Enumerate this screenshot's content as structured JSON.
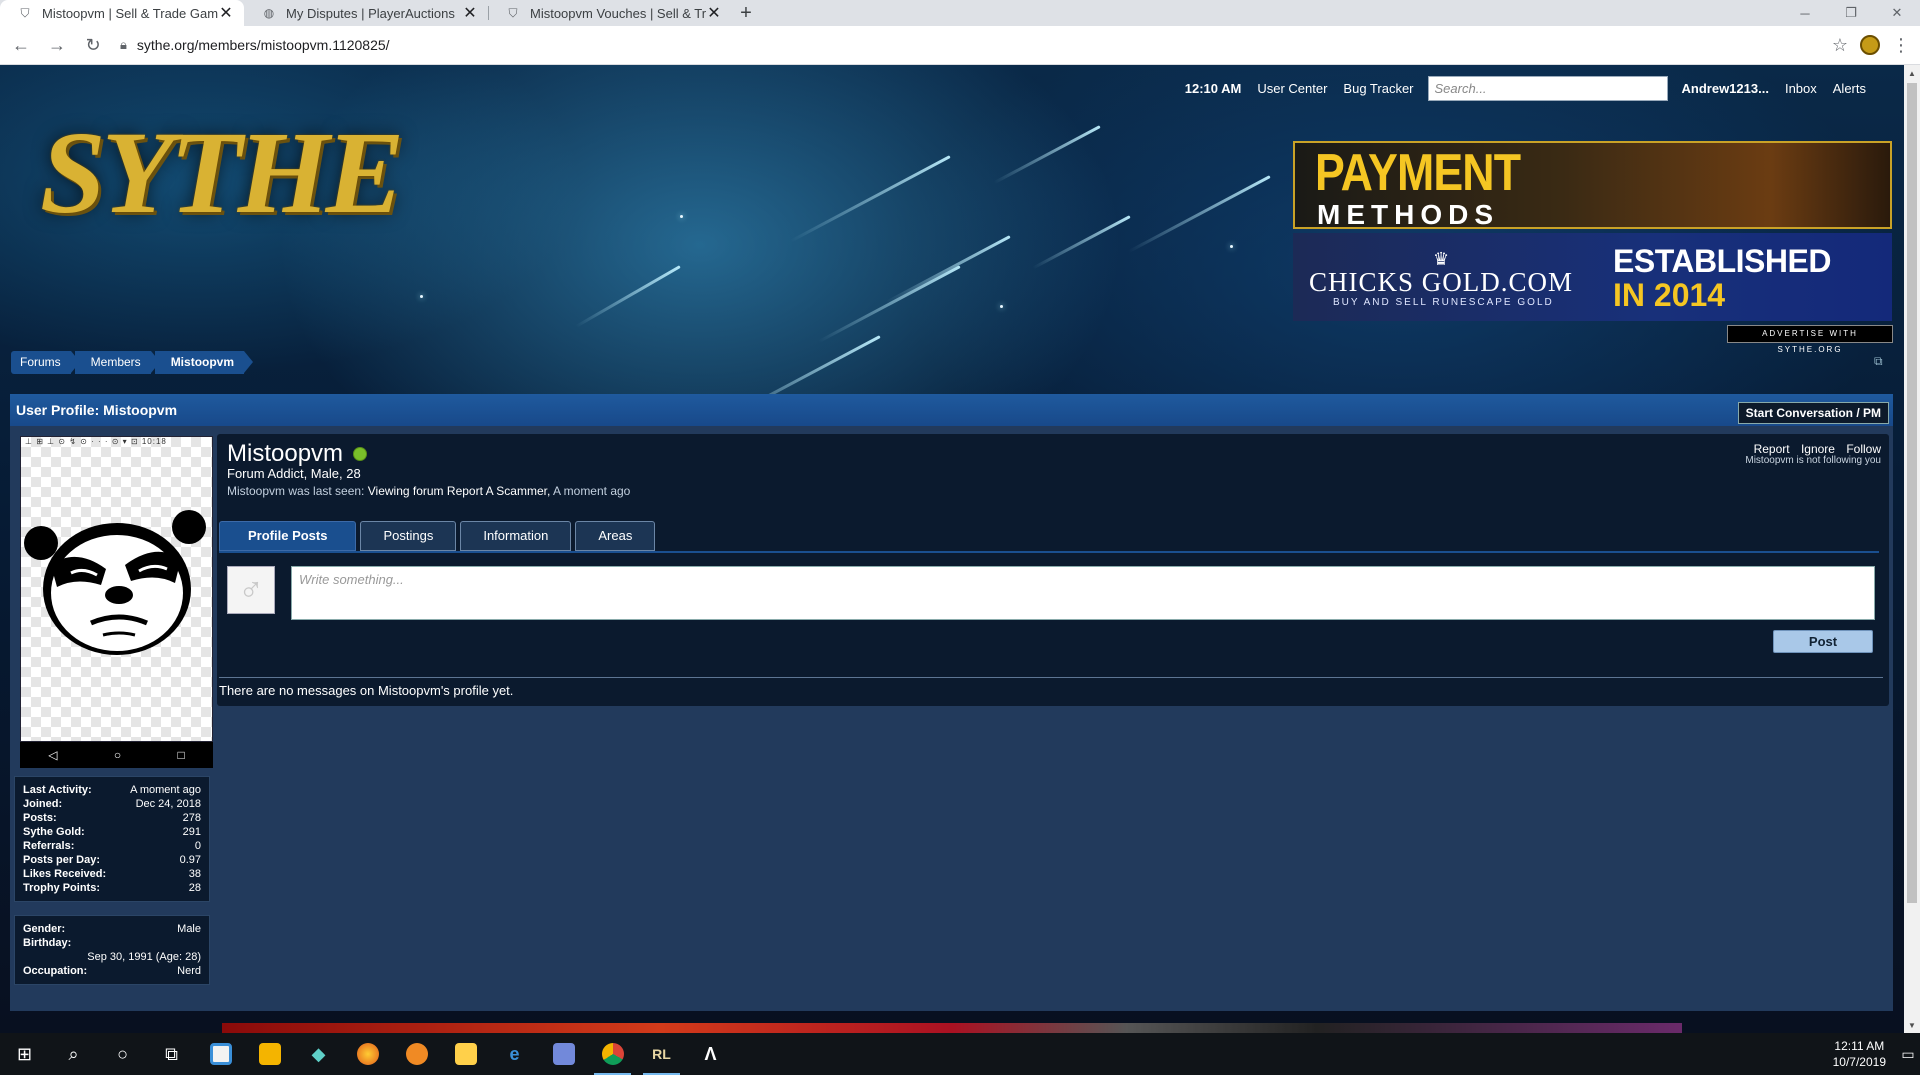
{
  "browser": {
    "tabs": [
      {
        "title": "Mistoopvm | Sell & Trade Game",
        "icon": "shield-icon",
        "active": true
      },
      {
        "title": "My Disputes | PlayerAuctions",
        "icon": "globe-icon",
        "active": false
      },
      {
        "title": "Mistoopvm Vouches | Sell & Trad",
        "icon": "shield-icon",
        "active": false
      }
    ],
    "close_glyph": "✕",
    "new_tab_glyph": "+",
    "url": "sythe.org/members/mistoopvm.1120825/"
  },
  "site": {
    "logo_text": "SYTHE",
    "time": "12:10 AM",
    "user_center": "User Center",
    "bug_tracker": "Bug Tracker",
    "search_placeholder": "Search...",
    "username": "Andrew1213...",
    "inbox": "Inbox",
    "alerts": "Alerts"
  },
  "ads": {
    "ad1_line1": "PAYMENT",
    "ad1_line2": "METHODS",
    "ad2_brand": "CHICKS GOLD.COM",
    "ad2_sub": "BUY AND SELL RUNESCAPE GOLD",
    "ad2_est": "ESTABLISHED",
    "ad2_year": "IN 2014",
    "advertise": "ADVERTISE WITH SYTHE.ORG"
  },
  "breadcrumb": [
    "Forums",
    "Members",
    "Mistoopvm"
  ],
  "profile": {
    "header": "User Profile: Mistoopvm",
    "start_conversation": "Start Conversation / PM",
    "name": "Mistoopvm",
    "title_line": "Forum Addict, Male, 28",
    "last_seen_prefix": "Mistoopvm was last seen:",
    "last_seen_action": "Viewing forum",
    "last_seen_forum": "Report A Scammer,",
    "last_seen_time": "A moment ago",
    "actions": {
      "report": "Report",
      "ignore": "Ignore",
      "follow": "Follow"
    },
    "follow_note": "Mistoopvm is not following you",
    "tabs": [
      "Profile Posts",
      "Postings",
      "Information",
      "Areas"
    ],
    "write_placeholder": "Write something...",
    "post_button": "Post",
    "no_messages": "There are no messages on Mistoopvm's profile yet.",
    "avatar_status_text": "⊥ ⊞ ⊥ ⊙ ↯ ⊙ · · · ⊙ ▾ ⊡  10:18",
    "stats": [
      {
        "k": "Last Activity:",
        "v": "A moment ago"
      },
      {
        "k": "Joined:",
        "v": "Dec 24, 2018"
      },
      {
        "k": "Posts:",
        "v": "278"
      },
      {
        "k": "Sythe Gold:",
        "v": "291"
      },
      {
        "k": "Referrals:",
        "v": "0"
      },
      {
        "k": "Posts per Day:",
        "v": "0.97"
      },
      {
        "k": "Likes Received:",
        "v": "38"
      },
      {
        "k": "Trophy Points:",
        "v": "28"
      }
    ],
    "gender_label": "Gender:",
    "gender": "Male",
    "birthday_label": "Birthday:",
    "birthday": "Sep 30, 1991 (Age: 28)",
    "occupation_label": "Occupation:",
    "occupation": "Nerd"
  },
  "taskbar": {
    "time": "12:11 AM",
    "date": "10/7/2019"
  }
}
